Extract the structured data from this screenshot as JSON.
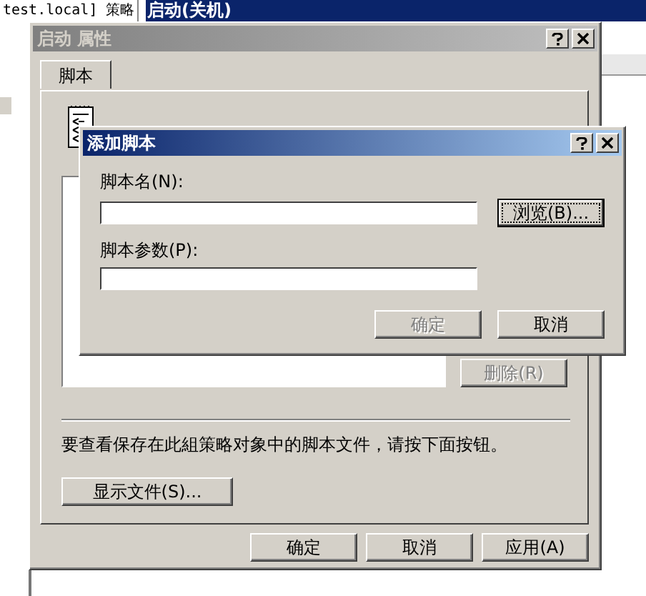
{
  "background_window": {
    "title": "启动(关机)",
    "path_label": "test.local] 策略"
  },
  "properties_dialog": {
    "title": "启动 属性",
    "active": false,
    "tabs": [
      {
        "label": "脚本",
        "selected": true
      }
    ],
    "remove_button": {
      "label": "删除(R)",
      "disabled": true
    },
    "hint": "要查看保存在此組策略对象中的脚本文件，请按下面按钮。",
    "show_files_button": {
      "label": "显示文件(S)...",
      "disabled": false
    },
    "buttons": [
      {
        "label": "确定",
        "disabled": false
      },
      {
        "label": "取消",
        "disabled": false
      },
      {
        "label": "应用(A)",
        "disabled": false
      }
    ]
  },
  "add_script_dialog": {
    "title": "添加脚本",
    "active": true,
    "fields": [
      {
        "label": "脚本名(N):"
      },
      {
        "label": "脚本参数(P):"
      }
    ],
    "browse_button": {
      "label": "浏览(B)...",
      "focused": true
    },
    "buttons": [
      {
        "label": "确定",
        "disabled": true
      },
      {
        "label": "取消",
        "disabled": false
      }
    ]
  }
}
